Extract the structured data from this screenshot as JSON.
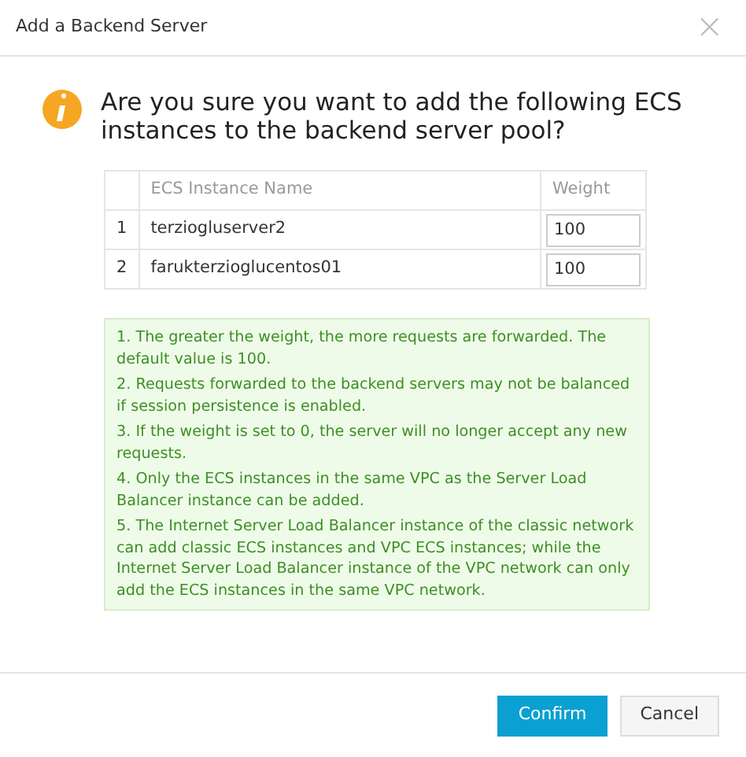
{
  "dialog": {
    "title": "Add a Backend Server",
    "close": "×"
  },
  "message": "Are you sure you want to add the following ECS instances to the backend server pool?",
  "table": {
    "columns": [
      "ECS Instance Name",
      "Weight"
    ],
    "rows": [
      {
        "index": "1",
        "name": "terziogluserver2",
        "weight": "100"
      },
      {
        "index": "2",
        "name": "farukterzioglucentos01",
        "weight": "100"
      }
    ]
  },
  "notes": [
    "1. The greater the weight, the more requests are forwarded. The default value is 100.",
    "2. Requests forwarded to the backend servers may not be balanced if session persistence is enabled.",
    "3. If the weight is set to 0, the server will no longer accept any new requests.",
    "4. Only the ECS instances in the same VPC as the Server Load Balancer instance can be added.",
    "5. The Internet Server Load Balancer instance of the classic network can add classic ECS instances and VPC ECS instances; while the Internet Server Load Balancer instance of the VPC network can only add the ECS instances in the same VPC network."
  ],
  "buttons": [
    {
      "label": "Confirm",
      "kind": "primary"
    },
    {
      "label": "Cancel",
      "kind": "secondary"
    }
  ]
}
